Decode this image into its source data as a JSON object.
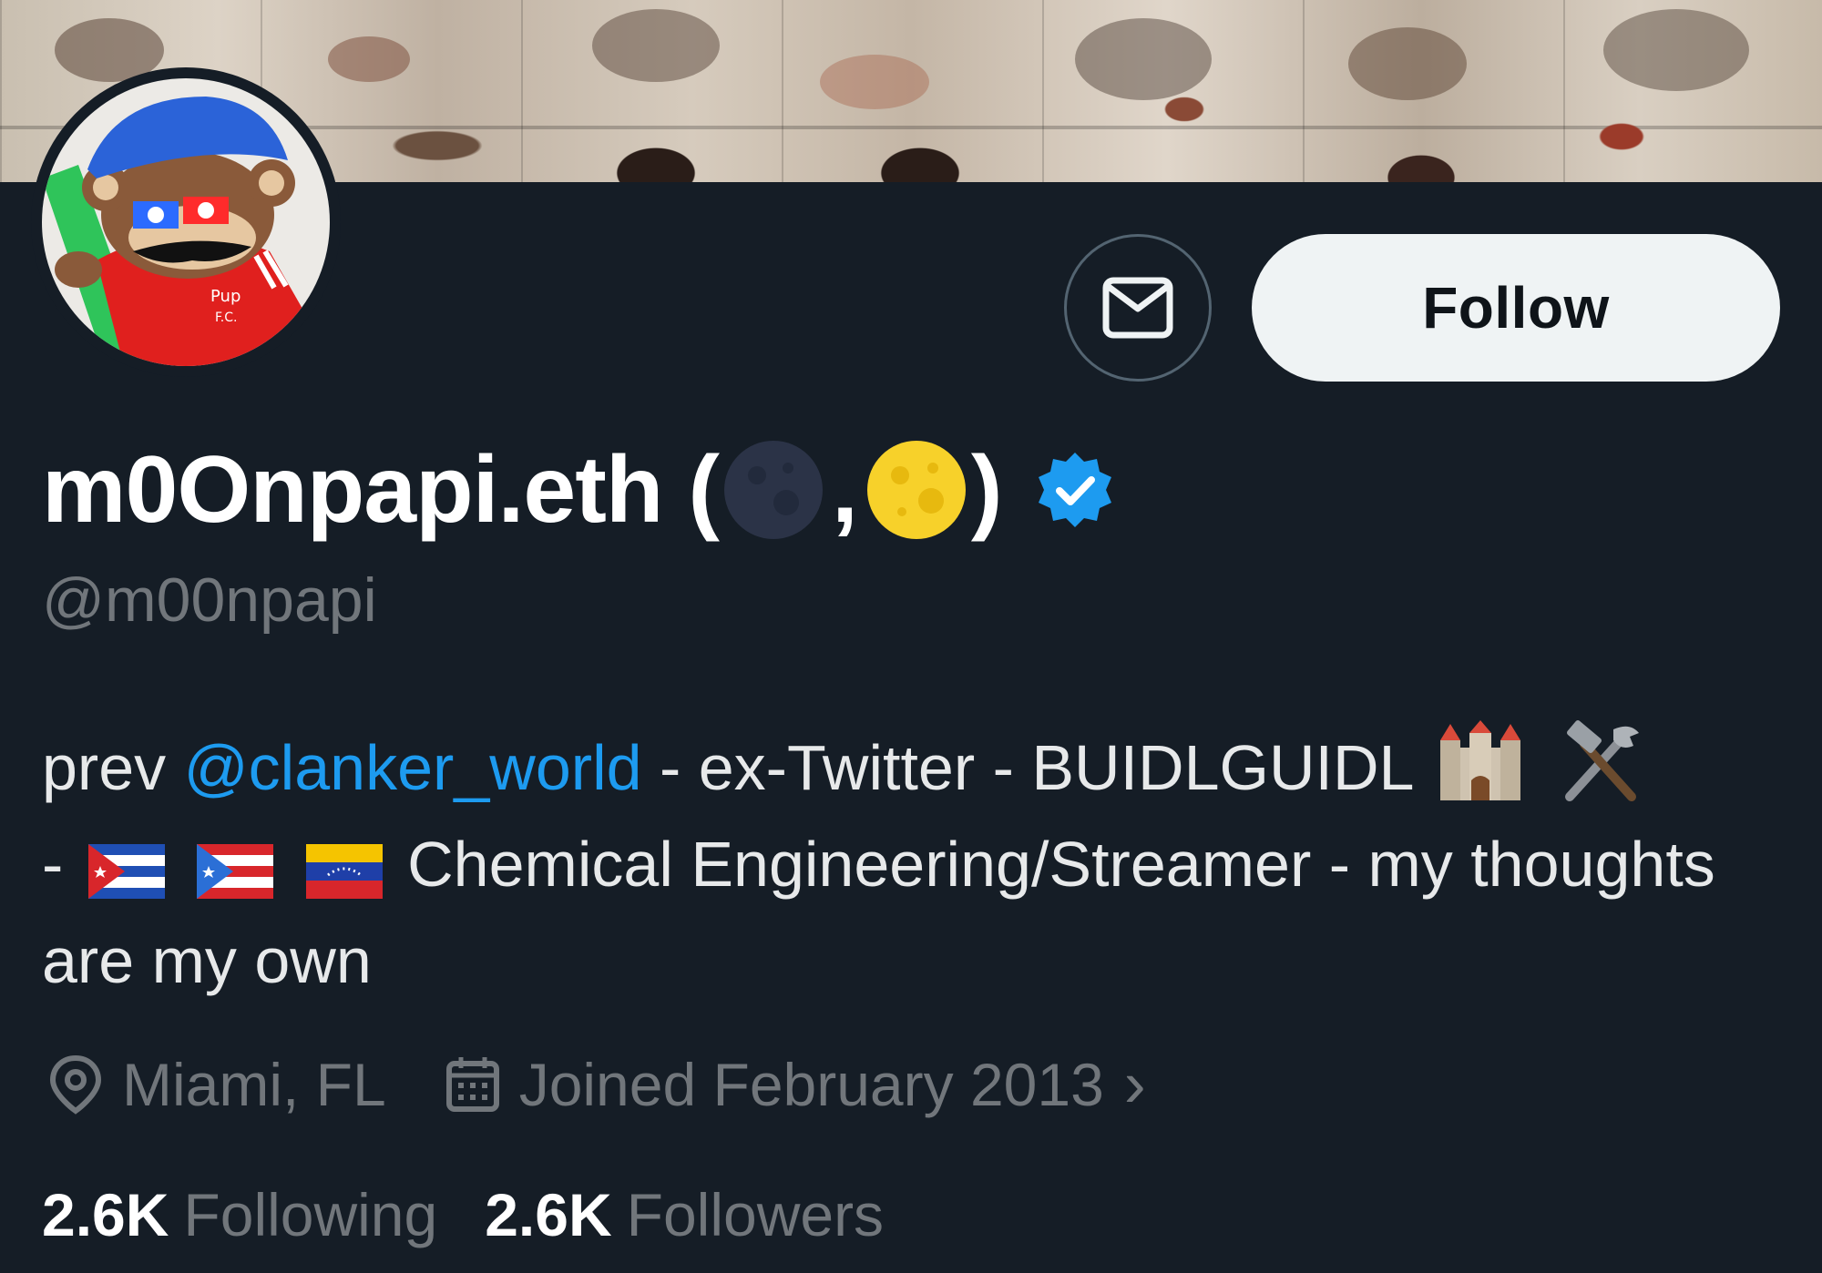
{
  "profile": {
    "display_name": "m0Onpapi.eth (",
    "name_comma": ",",
    "name_close": ")",
    "handle": "@m00npapi",
    "avatar_text_line1": "Pup",
    "avatar_text_line2": "F.C.",
    "verified": true,
    "verified_color": "#1d9bf0",
    "name_emojis": [
      "new-moon",
      "full-moon"
    ]
  },
  "actions": {
    "message_icon": "envelope-icon",
    "follow_label": "Follow"
  },
  "bio": {
    "prefix": "prev ",
    "mention": "@clanker_world",
    "segment1": " - ex-Twitter - BUIDLGUIDL",
    "line2_dash": "- ",
    "flags": [
      "cuba-flag",
      "puerto-rico-flag",
      "venezuela-flag"
    ],
    "segment2": "Chemical Engineering/Streamer - my thoughts are my own",
    "emojis": [
      "castle-emoji",
      "hammer-and-wrench-emoji"
    ]
  },
  "meta": {
    "location": "Miami, FL",
    "joined": "Joined February 2013",
    "joined_chevron": "›"
  },
  "stats": {
    "following_count": "2.6K",
    "following_label": "Following",
    "followers_count": "2.6K",
    "followers_label": "Followers"
  },
  "colors": {
    "background": "#151d26",
    "accent_link": "#1d9bf0",
    "muted_text": "#71767b",
    "follow_button_bg": "#eff3f4"
  }
}
